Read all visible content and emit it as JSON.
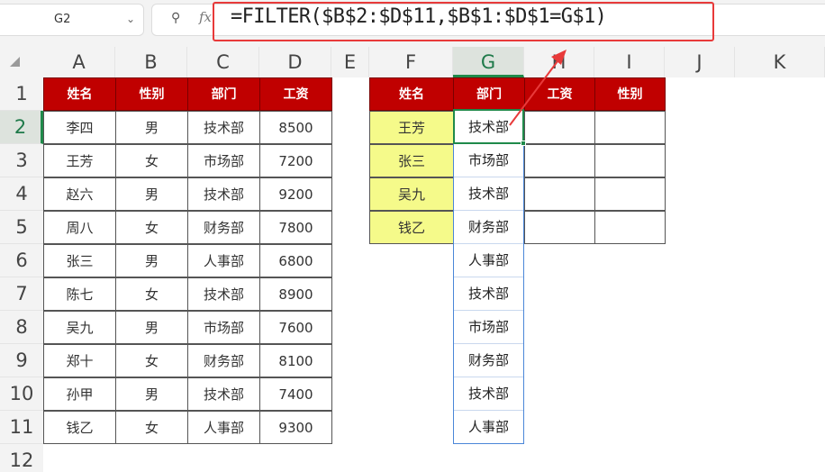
{
  "name_box": {
    "value": "G2",
    "dropdown_icon": "chevron-down-icon"
  },
  "formula_bar": {
    "zoom_icon": "zoom-icon",
    "fx_label": "fx",
    "formula": "=FILTER($B$2:$D$11,$B$1:$D$1=G$1)"
  },
  "columns": [
    "A",
    "B",
    "C",
    "D",
    "E",
    "F",
    "G",
    "H",
    "I",
    "J",
    "K"
  ],
  "active_column": "G",
  "rows": [
    "1",
    "2",
    "3",
    "4",
    "5",
    "6",
    "7",
    "8",
    "9",
    "10",
    "11",
    "12"
  ],
  "active_row": "2",
  "source_table": {
    "headers": [
      "姓名",
      "性别",
      "部门",
      "工资"
    ],
    "rows": [
      [
        "李四",
        "男",
        "技术部",
        "8500"
      ],
      [
        "王芳",
        "女",
        "市场部",
        "7200"
      ],
      [
        "赵六",
        "男",
        "技术部",
        "9200"
      ],
      [
        "周八",
        "女",
        "财务部",
        "7800"
      ],
      [
        "张三",
        "男",
        "人事部",
        "6800"
      ],
      [
        "陈七",
        "女",
        "技术部",
        "8900"
      ],
      [
        "吴九",
        "男",
        "市场部",
        "7600"
      ],
      [
        "郑十",
        "女",
        "财务部",
        "8100"
      ],
      [
        "孙甲",
        "男",
        "技术部",
        "7400"
      ],
      [
        "钱乙",
        "女",
        "人事部",
        "9300"
      ]
    ]
  },
  "lookup_table": {
    "headers": [
      "姓名",
      "部门",
      "工资",
      "性别"
    ],
    "names": [
      "王芳",
      "张三",
      "吴九",
      "钱乙"
    ],
    "name_highlight_color": "#f5fa8a",
    "header_color": "#c00000"
  },
  "spill_results": [
    "技术部",
    "市场部",
    "技术部",
    "财务部",
    "人事部",
    "技术部",
    "市场部",
    "财务部",
    "技术部",
    "人事部"
  ],
  "annotation_color": "#e83a3a"
}
